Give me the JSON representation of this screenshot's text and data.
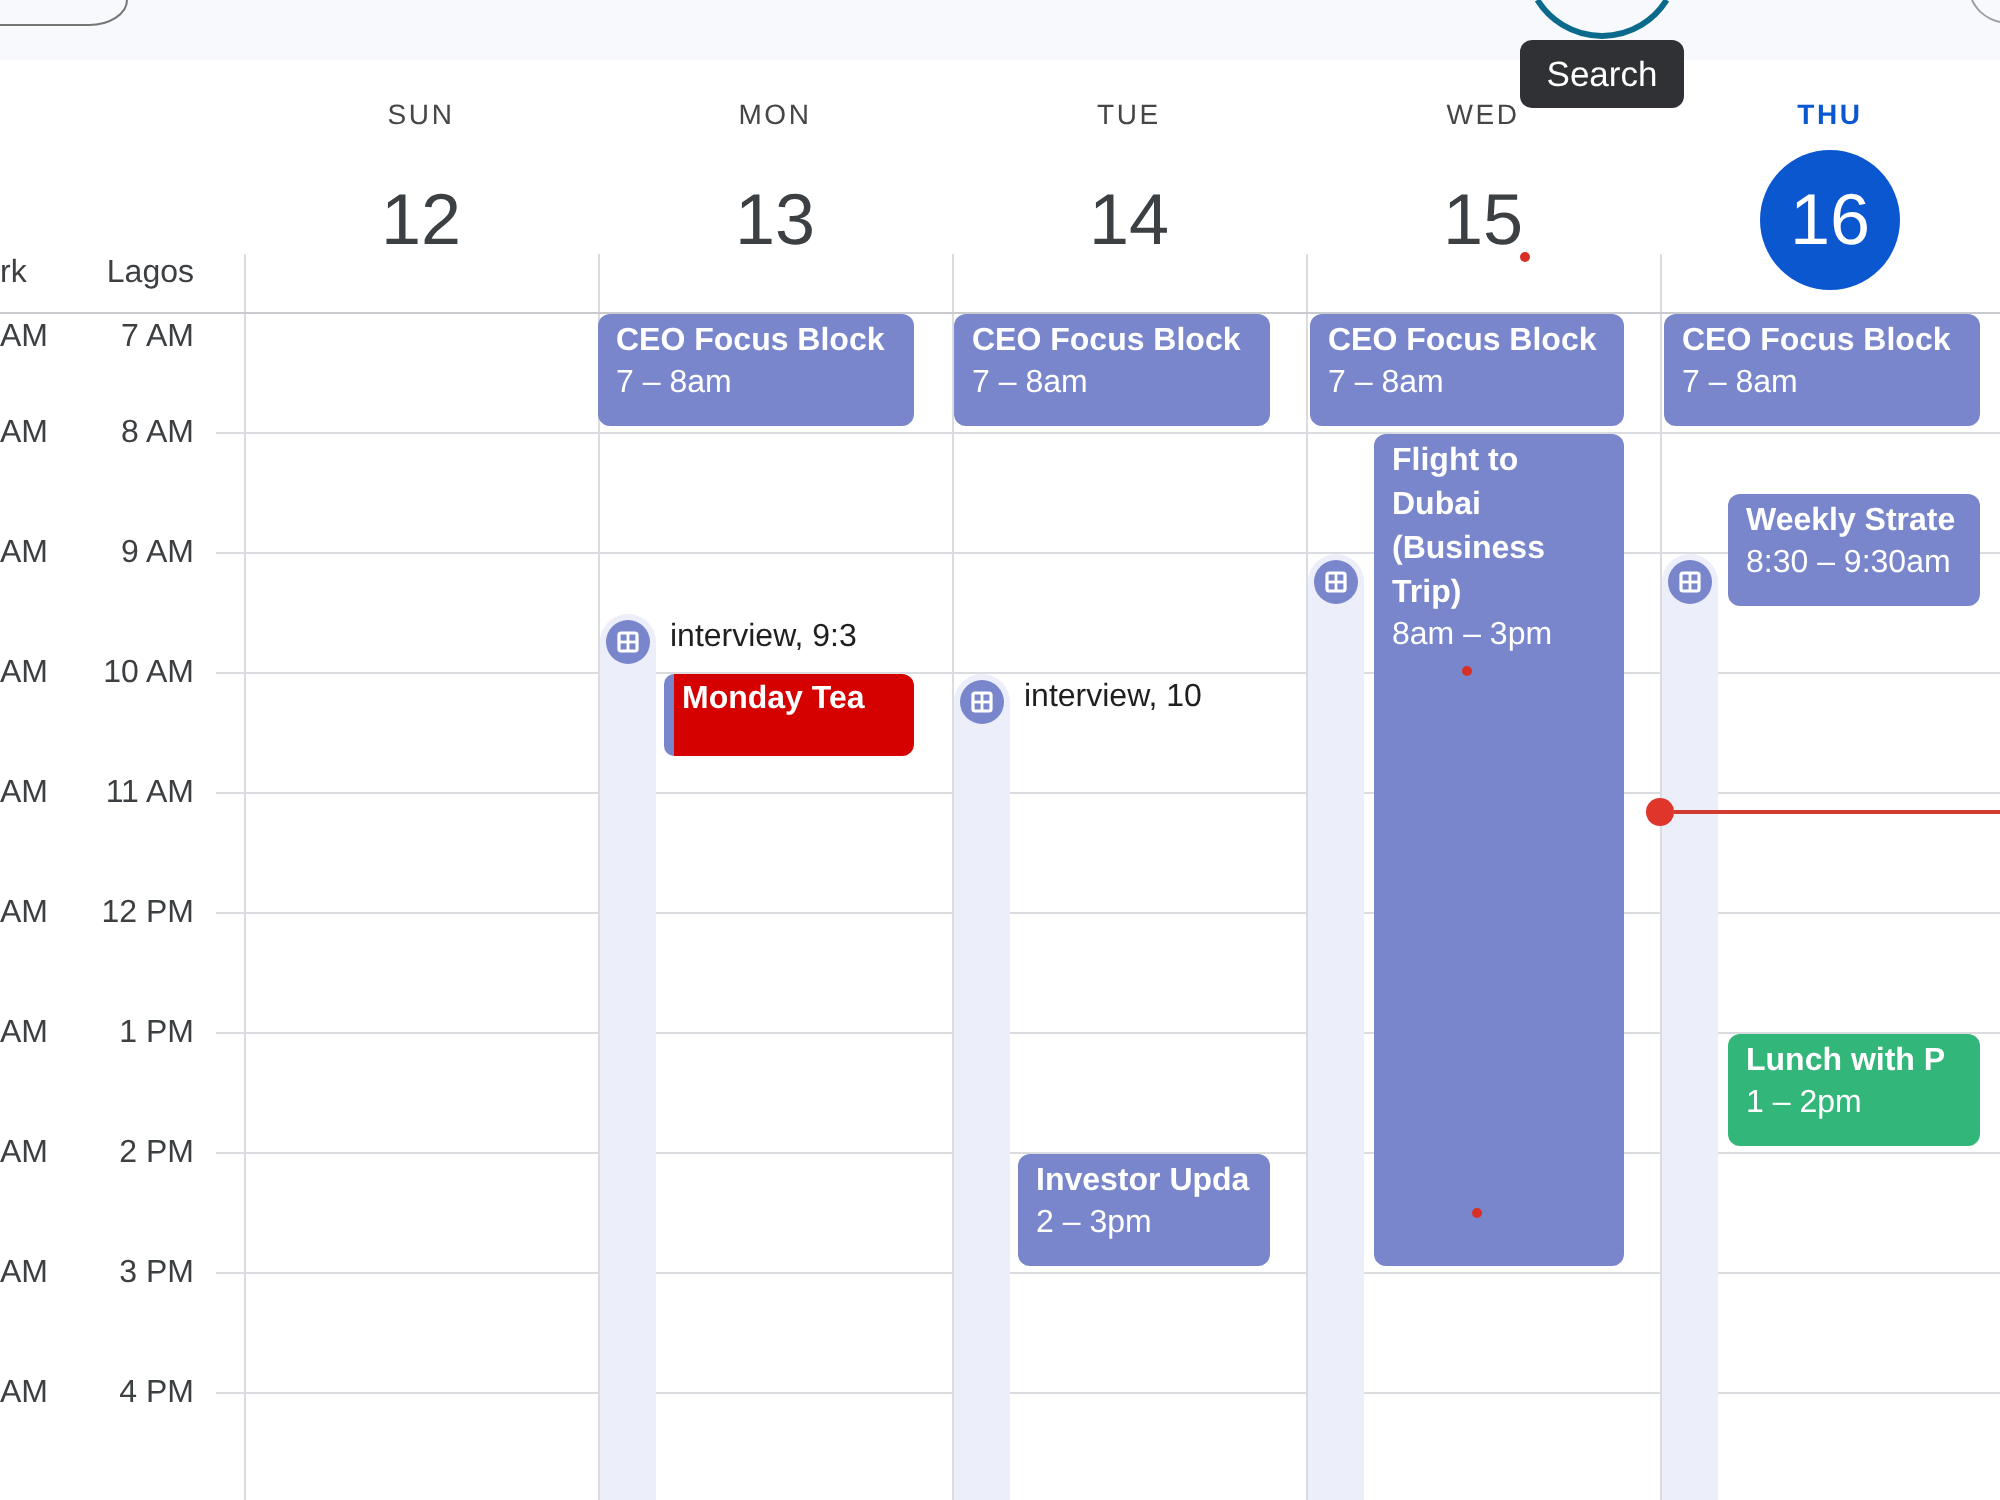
{
  "top_bar": {
    "tooltip": "Search"
  },
  "timezones": [
    {
      "label": "rk"
    },
    {
      "label": "Lagos"
    }
  ],
  "hours": [
    {
      "secondary": "AM",
      "primary": "7 AM"
    },
    {
      "secondary": "AM",
      "primary": "8 AM"
    },
    {
      "secondary": "AM",
      "primary": "9 AM"
    },
    {
      "secondary": "AM",
      "primary": "10 AM"
    },
    {
      "secondary": "AM",
      "primary": "11 AM"
    },
    {
      "secondary": "AM",
      "primary": "12 PM"
    },
    {
      "secondary": "AM",
      "primary": "1 PM"
    },
    {
      "secondary": "AM",
      "primary": "2 PM"
    },
    {
      "secondary": "AM",
      "primary": "3 PM"
    },
    {
      "secondary": "AM",
      "primary": "4 PM"
    }
  ],
  "days": [
    {
      "name": "SUN",
      "date": "12",
      "today": false,
      "appointment_slot": false
    },
    {
      "name": "MON",
      "date": "13",
      "today": false,
      "appointment_slot": true,
      "appointment_label": "interview, 9:3",
      "events": [
        {
          "title": "CEO Focus Block",
          "time": "7 – 8am",
          "color": "#7986cb"
        },
        {
          "title": "Monday Tea",
          "color": "#d50000"
        }
      ]
    },
    {
      "name": "TUE",
      "date": "14",
      "today": false,
      "appointment_slot": true,
      "appointment_label": "interview, 10",
      "events": [
        {
          "title": "CEO Focus Block",
          "time": "7 – 8am",
          "color": "#7986cb"
        },
        {
          "title": "Investor Upda",
          "time": "2 – 3pm",
          "color": "#7986cb"
        }
      ]
    },
    {
      "name": "WED",
      "date": "15",
      "today": false,
      "appointment_slot": true,
      "events": [
        {
          "title": "CEO Focus Block",
          "time": "7 – 8am",
          "color": "#7986cb"
        },
        {
          "title": "Flight to Dubai (Business Trip)",
          "time": "8am – 3pm",
          "color": "#7986cb"
        }
      ]
    },
    {
      "name": "THU",
      "date": "16",
      "today": true,
      "appointment_slot": true,
      "events": [
        {
          "title": "CEO Focus Block",
          "time": "7 – 8am",
          "color": "#7986cb"
        },
        {
          "title": "Weekly Strate",
          "time": "8:30 – 9:30am",
          "color": "#7986cb"
        },
        {
          "title": "Lunch with P",
          "time": "1 – 2pm",
          "color": "#33b679"
        }
      ]
    }
  ]
}
